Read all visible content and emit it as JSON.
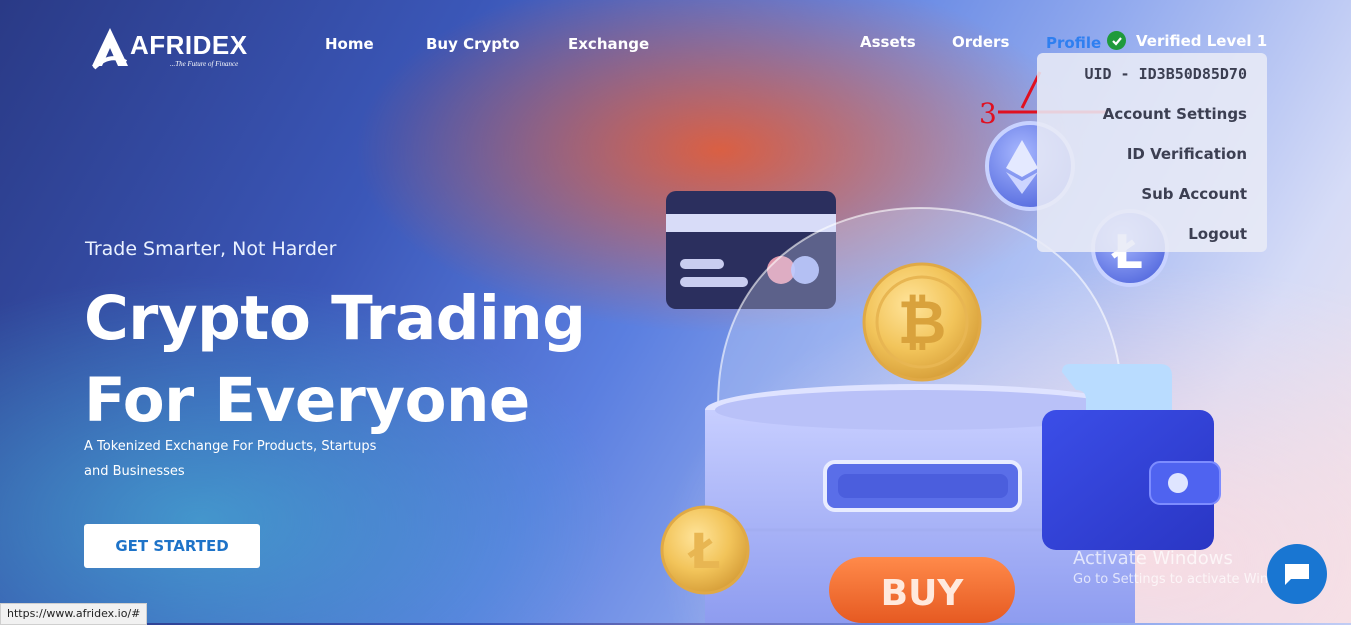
{
  "header": {
    "logo_text": "AFRIDEX",
    "logo_tagline": "...The Future of Finance",
    "nav": [
      "Home",
      "Buy Crypto",
      "Exchange",
      "Assets",
      "Orders",
      "Profile"
    ],
    "verified_label": "Verified Level 1"
  },
  "profile_menu": {
    "uid": "UID - ID3B50D85D70",
    "items": [
      "Account Settings",
      "ID Verification",
      "Sub Account",
      "Logout"
    ]
  },
  "annotation": {
    "number": "3"
  },
  "hero": {
    "subtitle": "Trade Smarter, Not Harder",
    "title_line1": "Crypto Trading",
    "title_line2": "For Everyone",
    "description": "A Tokenized Exchange For Products, Startups and Businesses",
    "cta": "GET STARTED",
    "buy_label": "BUY"
  },
  "status_bar": {
    "url": "https://www.afridex.io/#"
  },
  "windows_watermark": {
    "line1": "Activate Windows",
    "line2": "Go to Settings to activate Windows."
  },
  "colors": {
    "profile_link": "#2f7ff0",
    "verified_check": "#1f9a3c",
    "cta_text": "#1e73c8",
    "buy_button": "#f06a30",
    "chat_button": "#1976d2",
    "annotation": "#e01020"
  },
  "icons": [
    "afridex-logo-icon",
    "verified-check-icon",
    "ethereum-coin-icon",
    "litecoin-coin-icon",
    "bitcoin-coin-icon",
    "chat-icon"
  ]
}
